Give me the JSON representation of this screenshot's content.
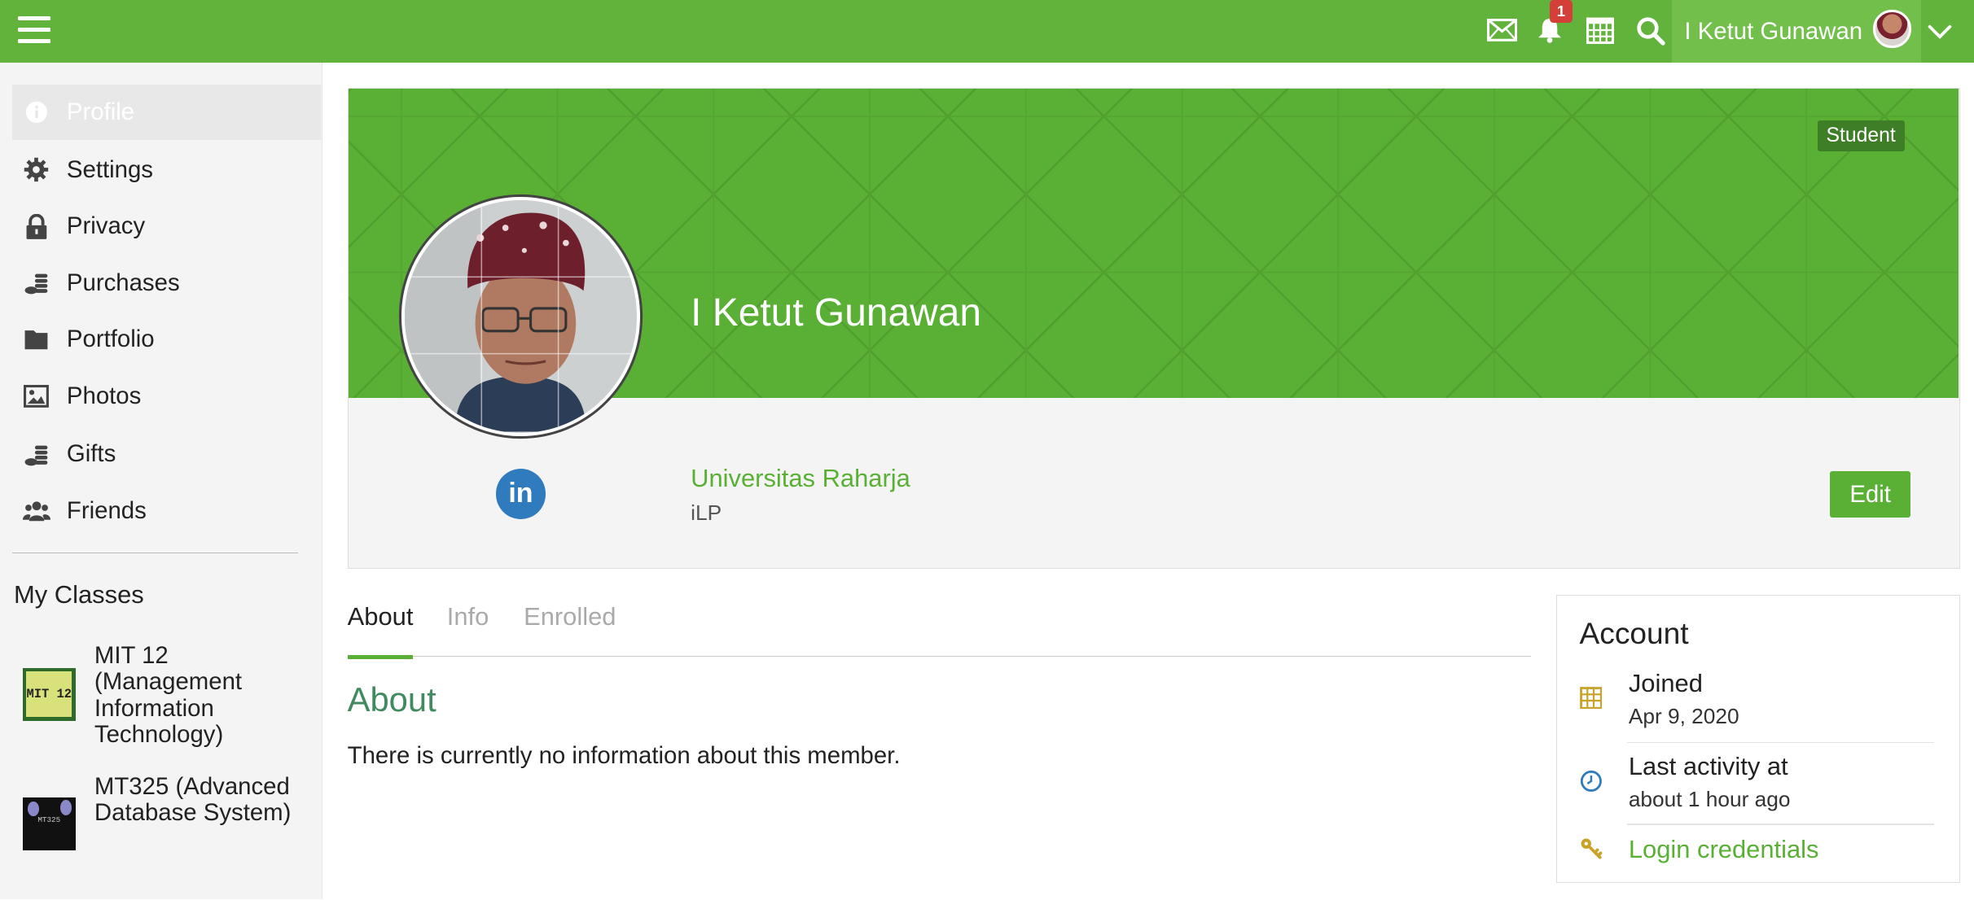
{
  "topbar": {
    "menu_icon": "hamburger-icon",
    "notifications_count": "1",
    "user_name": "I Ketut Gunawan",
    "colors": {
      "bar": "#62b33b",
      "user_area": "#72bf4c",
      "badge": "#d43f3a"
    }
  },
  "sidebar": {
    "items": [
      {
        "label": "Profile",
        "icon": "info-icon"
      },
      {
        "label": "Settings",
        "icon": "gear-icon"
      },
      {
        "label": "Privacy",
        "icon": "lock-icon"
      },
      {
        "label": "Purchases",
        "icon": "coins-icon"
      },
      {
        "label": "Portfolio",
        "icon": "folder-icon"
      },
      {
        "label": "Photos",
        "icon": "image-icon"
      },
      {
        "label": "Gifts",
        "icon": "coins-icon"
      },
      {
        "label": "Friends",
        "icon": "users-icon"
      }
    ],
    "classes_heading": "My Classes",
    "classes": [
      {
        "name": "MIT 12 (Management Information Technology)",
        "thumb_text": "MIT 12"
      },
      {
        "name": "MT325 (Advanced Database System)",
        "thumb_text": "MT325"
      }
    ]
  },
  "profile": {
    "role_badge": "Student",
    "name": "I Ketut Gunawan",
    "organization": "Universitas Raharja",
    "organization_sub": "iLP",
    "edit_label": "Edit",
    "social": "in",
    "brand_color": "#5aaf35"
  },
  "tabs": [
    {
      "label": "About"
    },
    {
      "label": "Info"
    },
    {
      "label": "Enrolled"
    }
  ],
  "about": {
    "heading": "About",
    "text": "There is currently no information about this member."
  },
  "account": {
    "heading": "Account",
    "joined_label": "Joined",
    "joined_date": "Apr 9, 2020",
    "activity_label": "Last activity at",
    "activity_value": "about 1 hour ago",
    "login_label": "Login credentials"
  }
}
